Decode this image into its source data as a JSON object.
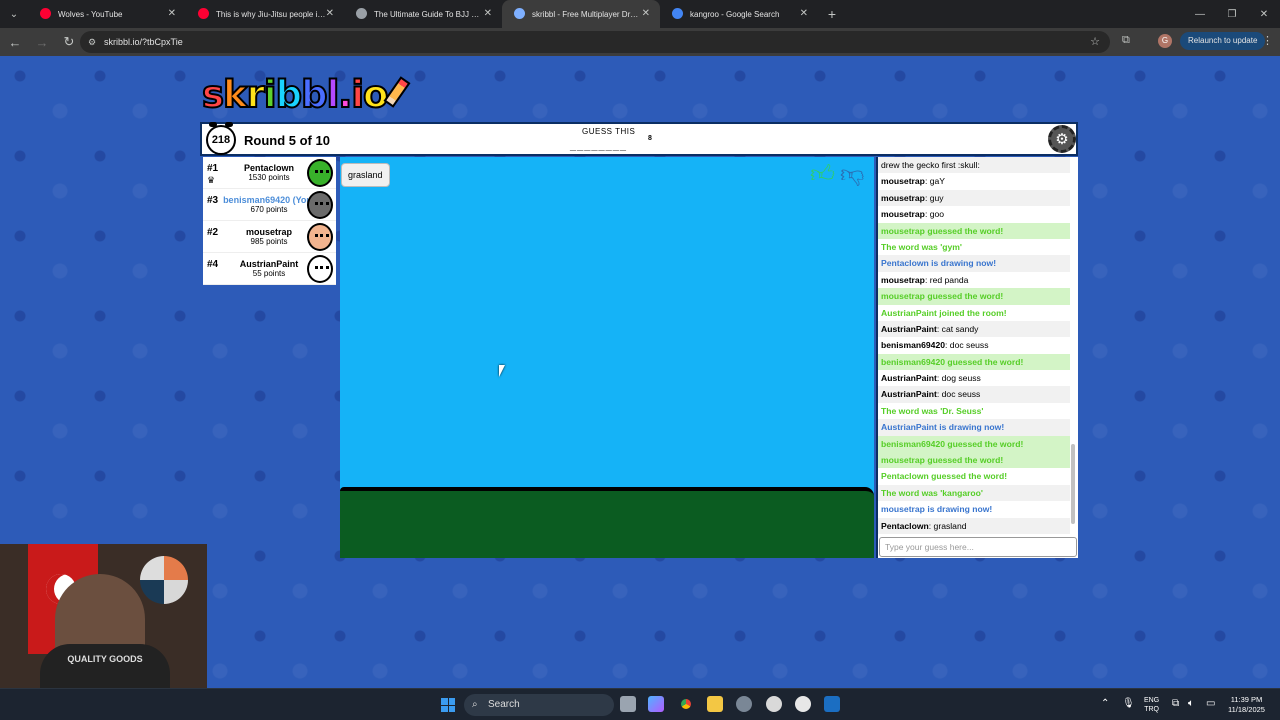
{
  "browser": {
    "tabs": [
      {
        "title": "Wolves - YouTube",
        "favicon": "youtube-icon",
        "color": "#ff0033",
        "active": false
      },
      {
        "title": "This is why Jiu-Jitsu people inju",
        "favicon": "youtube-icon",
        "color": "#ff0033",
        "active": false
      },
      {
        "title": "The Ultimate Guide To BJJ Solo",
        "favicon": "globe-icon",
        "color": "#9aa0a6",
        "active": false
      },
      {
        "title": "skribbl - Free Multiplayer Drawi",
        "favicon": "skribbl-icon",
        "color": "#7fb0ff",
        "active": true
      },
      {
        "title": "kangroo - Google Search",
        "favicon": "google-icon",
        "color": "#4285f4",
        "active": false
      }
    ],
    "url": "skribbl.io/?tbCpxTie",
    "relaunch_label": "Relaunch to update",
    "profile_initial": "G"
  },
  "game": {
    "logo_text": "skribbl.io",
    "timer": "218",
    "round_label": "Round 5 of 10",
    "guess_title": "GUESS THIS",
    "guess_blanks": "________",
    "guess_length": "8",
    "drawn_word_bubble": "grasland",
    "players": [
      {
        "rank": "#1",
        "name": "Pentaclown",
        "points": "1530 points",
        "crown": true,
        "me": false,
        "avatar_color": "#38b12a"
      },
      {
        "rank": "#3",
        "name": "benisman69420 (You)",
        "points": "670 points",
        "crown": false,
        "me": true,
        "avatar_color": "#6b6b6b"
      },
      {
        "rank": "#2",
        "name": "mousetrap",
        "points": "985 points",
        "crown": false,
        "me": false,
        "avatar_color": "#f2b48f"
      },
      {
        "rank": "#4",
        "name": "AustrianPaint",
        "points": "55 points",
        "crown": false,
        "me": false,
        "avatar_color": "#ffffff"
      }
    ],
    "chat": [
      {
        "type": "plain",
        "text": "drew the gecko first :skull:"
      },
      {
        "type": "msg",
        "user": "mousetrap",
        "text": "gaY"
      },
      {
        "type": "msg",
        "user": "mousetrap",
        "text": "guy"
      },
      {
        "type": "msg",
        "user": "mousetrap",
        "text": "goo"
      },
      {
        "type": "guessed",
        "text": "mousetrap guessed the word!"
      },
      {
        "type": "good",
        "text": "The word was 'gym'"
      },
      {
        "type": "draw",
        "text": "Pentaclown is drawing now!"
      },
      {
        "type": "msg",
        "user": "mousetrap",
        "text": "red panda"
      },
      {
        "type": "guessed",
        "text": "mousetrap guessed the word!"
      },
      {
        "type": "good",
        "text": "AustrianPaint joined the room!"
      },
      {
        "type": "msg",
        "user": "AustrianPaint",
        "text": "cat sandy"
      },
      {
        "type": "msg",
        "user": "benisman69420",
        "text": "doc seuss"
      },
      {
        "type": "guessed",
        "text": "benisman69420 guessed the word!"
      },
      {
        "type": "msg",
        "user": "AustrianPaint",
        "text": "dog seuss"
      },
      {
        "type": "msg",
        "user": "AustrianPaint",
        "text": "doc seuss"
      },
      {
        "type": "good",
        "text": "The word was 'Dr. Seuss'"
      },
      {
        "type": "draw",
        "text": "AustrianPaint is drawing now!"
      },
      {
        "type": "guessed",
        "text": "benisman69420 guessed the word!"
      },
      {
        "type": "guessed",
        "text": "mousetrap guessed the word!"
      },
      {
        "type": "good",
        "text": "Pentaclown guessed the word!"
      },
      {
        "type": "good",
        "text": "The word was 'kangaroo'"
      },
      {
        "type": "draw",
        "text": "mousetrap is drawing now!"
      },
      {
        "type": "msg",
        "user": "Pentaclown",
        "text": "grasland"
      }
    ],
    "chat_placeholder": "Type your guess here...",
    "canvas_colors": {
      "sky": "#15b3f7",
      "ground": "#0b5c21"
    }
  },
  "webcam": {
    "shirt_text": "QUALITY GOODS"
  },
  "taskbar": {
    "search_label": "Search",
    "lang_line1": "ENG",
    "lang_line2": "TRQ",
    "time": "11:39 PM",
    "date": "11/18/2025"
  }
}
